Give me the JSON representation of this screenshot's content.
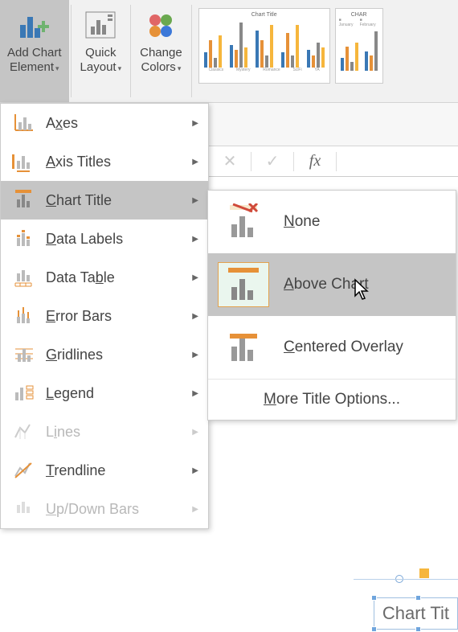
{
  "ribbon": {
    "add_chart_element": "Add Chart\nElement",
    "quick_layout": "Quick\nLayout",
    "change_colors": "Change\nColors",
    "thumb1_title": "Chart Title",
    "thumb2_title": "CHAR"
  },
  "fxbar": {
    "cancel": "✕",
    "accept": "✓",
    "fx": "fx"
  },
  "menu1": {
    "items": [
      {
        "label_pre": "A",
        "ul": "x",
        "label_post": "es"
      },
      {
        "label_pre": "",
        "ul": "A",
        "label_post": "xis Titles"
      },
      {
        "label_pre": "",
        "ul": "C",
        "label_post": "hart Title"
      },
      {
        "label_pre": "",
        "ul": "D",
        "label_post": "ata Labels"
      },
      {
        "label_pre": "Data Ta",
        "ul": "b",
        "label_post": "le"
      },
      {
        "label_pre": "",
        "ul": "E",
        "label_post": "rror Bars"
      },
      {
        "label_pre": "",
        "ul": "G",
        "label_post": "ridlines"
      },
      {
        "label_pre": "",
        "ul": "L",
        "label_post": "egend"
      },
      {
        "label_pre": "L",
        "ul": "i",
        "label_post": "nes"
      },
      {
        "label_pre": "",
        "ul": "T",
        "label_post": "rendline"
      },
      {
        "label_pre": "",
        "ul": "U",
        "label_post": "p/Down Bars"
      }
    ]
  },
  "menu2": {
    "none_pre": "",
    "none_ul": "N",
    "none_post": "one",
    "above_pre": "",
    "above_ul": "A",
    "above_post": "bove Chart",
    "centered_pre": "",
    "centered_ul": "C",
    "centered_post": "entered Overlay",
    "more_pre": "",
    "more_ul": "M",
    "more_post": "ore Title Options..."
  },
  "chart": {
    "title_placeholder": "Chart Tit"
  }
}
